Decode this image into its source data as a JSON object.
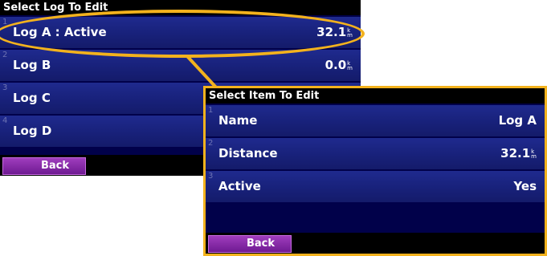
{
  "colors": {
    "accent": "#f3b21d",
    "screen_bg": "#01014a",
    "back_button": "#8a2bb0"
  },
  "log_screen": {
    "title": "Select Log To Edit",
    "items": [
      {
        "number": "1",
        "label": "Log A : Active",
        "value": "32.1",
        "unit_top": "k",
        "unit_bottom": "m"
      },
      {
        "number": "2",
        "label": "Log B",
        "value": "0.0",
        "unit_top": "k",
        "unit_bottom": "m"
      },
      {
        "number": "3",
        "label": "Log C"
      },
      {
        "number": "4",
        "label": "Log D"
      }
    ],
    "back_label": "Back"
  },
  "item_screen": {
    "title": "Select Item To Edit",
    "items": [
      {
        "number": "1",
        "label": "Name",
        "value": "Log A"
      },
      {
        "number": "2",
        "label": "Distance",
        "value": "32.1",
        "unit_top": "k",
        "unit_bottom": "m"
      },
      {
        "number": "3",
        "label": "Active",
        "value": "Yes"
      }
    ],
    "back_label": "Back"
  }
}
